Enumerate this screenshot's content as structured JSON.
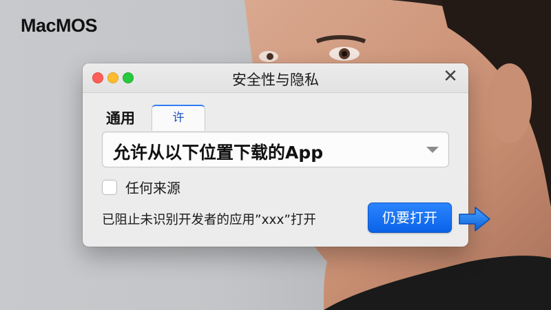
{
  "brand": {
    "name": "MacMOS"
  },
  "dialog": {
    "title": "安全性与隐私",
    "close_icon": "close-icon",
    "tabs": [
      {
        "label": "通用",
        "selected": false
      },
      {
        "label": "许",
        "selected": true
      }
    ],
    "allow_select": {
      "value": "允许从以下位置下载的App"
    },
    "checkbox": {
      "label": "任何来源",
      "checked": false
    },
    "blocked_message": "已阻止未识别开发者的应用”xxx”打开",
    "open_anyway_button": "仍要打开",
    "accent_color": "#0a63e6"
  }
}
